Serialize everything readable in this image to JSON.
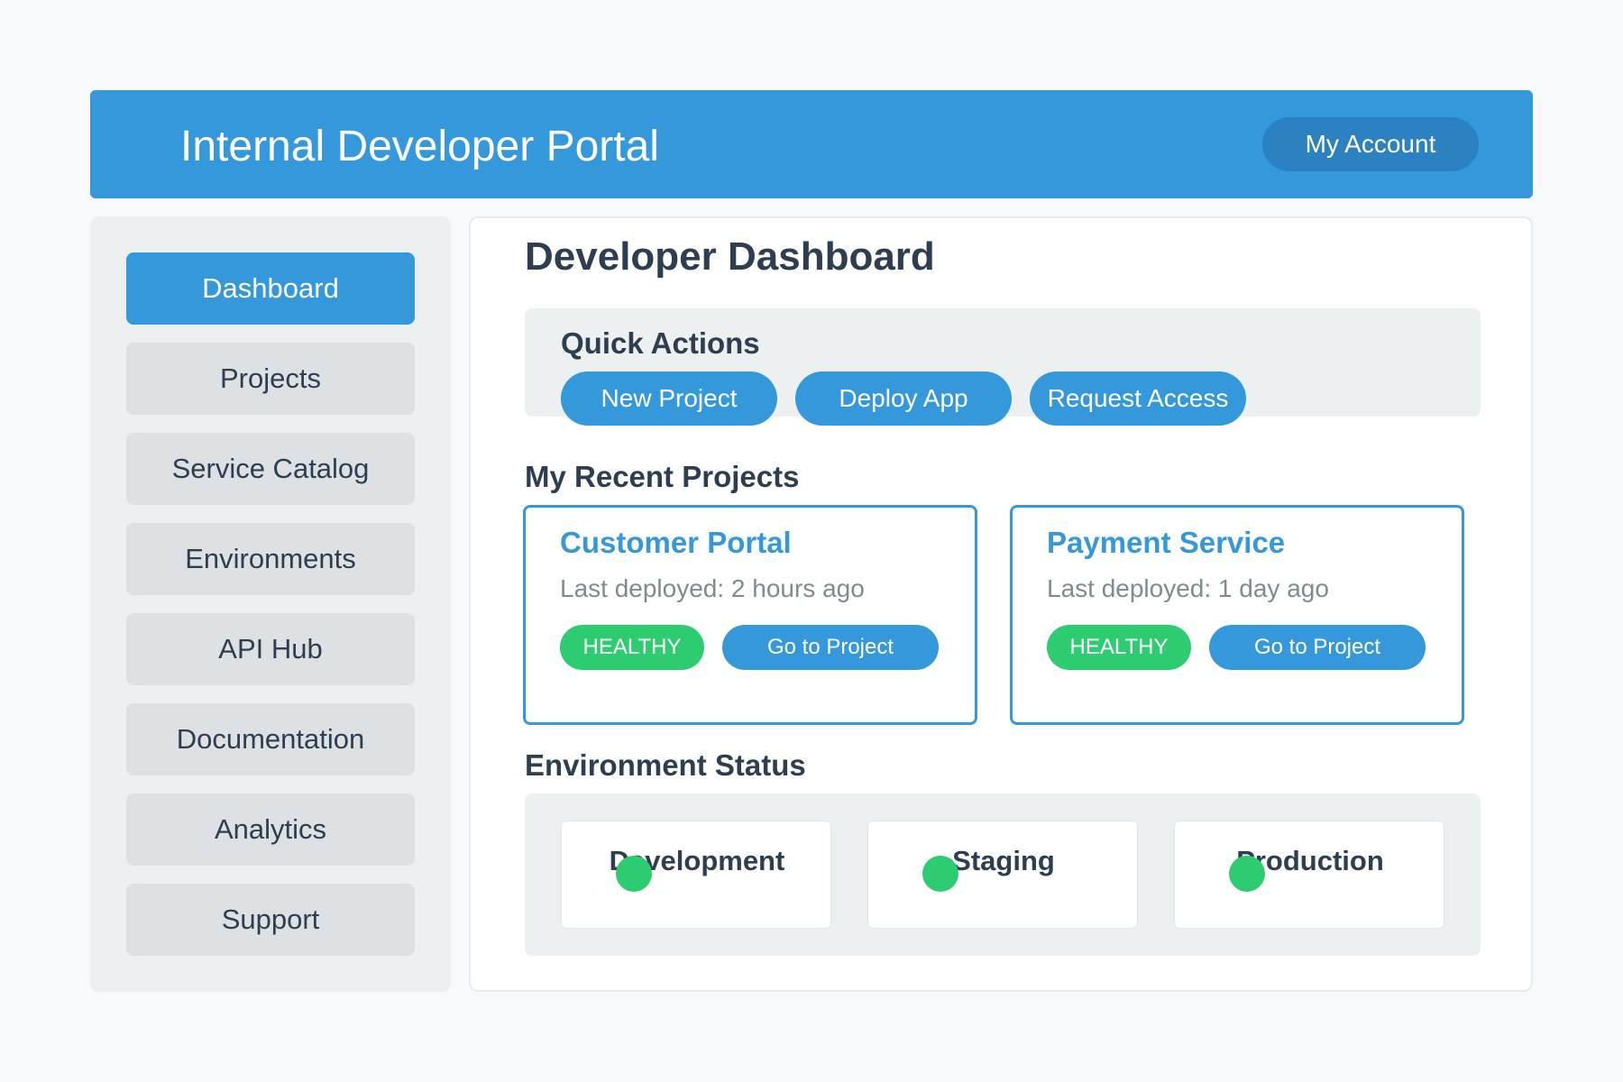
{
  "header": {
    "title": "Internal Developer Portal",
    "account_label": "My Account"
  },
  "sidebar": {
    "items": [
      {
        "label": "Dashboard",
        "active": true
      },
      {
        "label": "Projects",
        "active": false
      },
      {
        "label": "Service Catalog",
        "active": false
      },
      {
        "label": "Environments",
        "active": false
      },
      {
        "label": "API Hub",
        "active": false
      },
      {
        "label": "Documentation",
        "active": false
      },
      {
        "label": "Analytics",
        "active": false
      },
      {
        "label": "Support",
        "active": false
      }
    ]
  },
  "main": {
    "title": "Developer Dashboard",
    "quick_actions": {
      "heading": "Quick Actions",
      "buttons": [
        "New Project",
        "Deploy App",
        "Request Access"
      ]
    },
    "recent_projects": {
      "heading": "My Recent Projects",
      "items": [
        {
          "name": "Customer Portal",
          "deployed": "Last deployed: 2 hours ago",
          "status": "HEALTHY",
          "action": "Go to Project"
        },
        {
          "name": "Payment Service",
          "deployed": "Last deployed: 1 day ago",
          "status": "HEALTHY",
          "action": "Go to Project"
        }
      ]
    },
    "environment_status": {
      "heading": "Environment Status",
      "items": [
        {
          "name": "Development",
          "status_color": "#2ecc71"
        },
        {
          "name": "Staging",
          "status_color": "#2ecc71"
        },
        {
          "name": "Production",
          "status_color": "#2ecc71"
        }
      ]
    }
  },
  "colors": {
    "primary": "#3498db",
    "account_button": "#2c82c1",
    "healthy": "#2ecc71",
    "text": "#2c3e50",
    "muted": "#7f8c8d"
  }
}
